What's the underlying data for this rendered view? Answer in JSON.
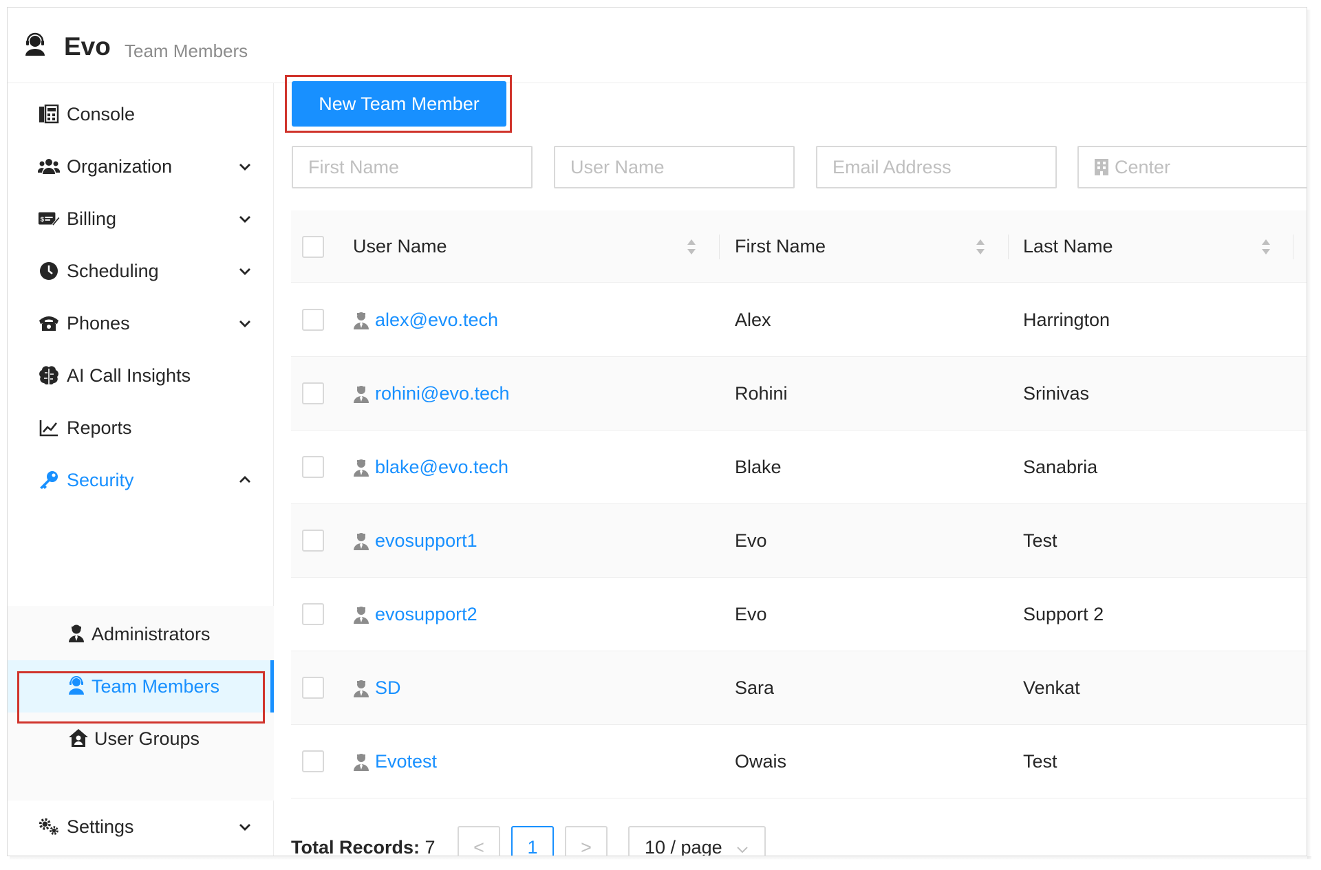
{
  "header": {
    "app_name": "Evo",
    "page_subtitle": "Team Members",
    "logo_icon": "headset-user-icon"
  },
  "sidebar": {
    "items": [
      {
        "label": "Console",
        "icon": "console-icon",
        "expandable": false
      },
      {
        "label": "Organization",
        "icon": "users-icon",
        "expandable": true
      },
      {
        "label": "Billing",
        "icon": "billing-icon",
        "expandable": true
      },
      {
        "label": "Scheduling",
        "icon": "clock-icon",
        "expandable": true
      },
      {
        "label": "Phones",
        "icon": "phone-icon",
        "expandable": true
      },
      {
        "label": "AI Call Insights",
        "icon": "brain-icon",
        "expandable": false
      },
      {
        "label": "Reports",
        "icon": "chart-line-icon",
        "expandable": false
      },
      {
        "label": "Security",
        "icon": "key-icon",
        "expandable": true,
        "expanded": true
      },
      {
        "label": "Settings",
        "icon": "cogs-icon",
        "expandable": true
      }
    ],
    "security_submenu": [
      {
        "label": "Administrators",
        "icon": "user-tie-icon"
      },
      {
        "label": "Team Members",
        "icon": "headset-user-icon",
        "selected": true
      },
      {
        "label": "User Groups",
        "icon": "house-user-icon"
      }
    ]
  },
  "toolbar": {
    "new_member_label": "New Team Member"
  },
  "filters": {
    "first_name_placeholder": "First Name",
    "user_name_placeholder": "User Name",
    "email_placeholder": "Email Address",
    "center_placeholder": "Center"
  },
  "table": {
    "columns": [
      "User Name",
      "First Name",
      "Last Name"
    ],
    "rows": [
      {
        "user_name": "alex@evo.tech",
        "first_name": "Alex",
        "last_name": "Harrington"
      },
      {
        "user_name": "rohini@evo.tech",
        "first_name": "Rohini",
        "last_name": "Srinivas"
      },
      {
        "user_name": "blake@evo.tech",
        "first_name": "Blake",
        "last_name": "Sanabria"
      },
      {
        "user_name": "evosupport1",
        "first_name": "Evo",
        "last_name": "Test"
      },
      {
        "user_name": "evosupport2",
        "first_name": "Evo",
        "last_name": "Support 2"
      },
      {
        "user_name": "SD",
        "first_name": "Sara",
        "last_name": "Venkat"
      },
      {
        "user_name": "Evotest",
        "first_name": "Owais",
        "last_name": "Test"
      }
    ]
  },
  "pagination": {
    "total_label": "Total Records:",
    "total_value": "7",
    "prev": "<",
    "next": ">",
    "current_page": "1",
    "page_size": "10 / page"
  },
  "colors": {
    "accent": "#1890ff",
    "highlight_box": "#d0342c"
  }
}
